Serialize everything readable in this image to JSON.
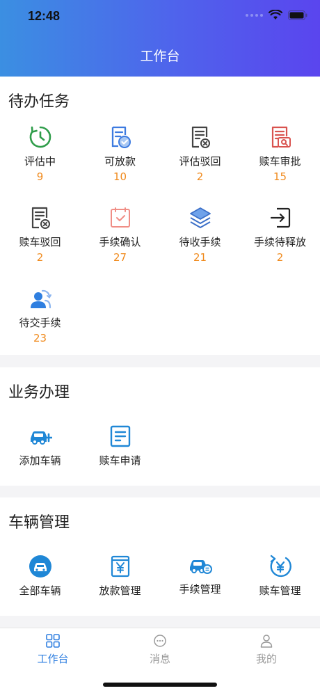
{
  "status": {
    "time": "12:48"
  },
  "header": {
    "title": "工作台"
  },
  "todo": {
    "title": "待办任务",
    "items": [
      {
        "label": "评估中",
        "count": "9",
        "icon": "clock-icon"
      },
      {
        "label": "可放款",
        "count": "10",
        "icon": "doc-check-icon"
      },
      {
        "label": "评估驳回",
        "count": "2",
        "icon": "doc-reject-icon"
      },
      {
        "label": "赎车审批",
        "count": "15",
        "icon": "doc-search-icon"
      },
      {
        "label": "赎车驳回",
        "count": "2",
        "icon": "doc-reject-icon"
      },
      {
        "label": "手续确认",
        "count": "27",
        "icon": "calendar-check-icon"
      },
      {
        "label": "待收手续",
        "count": "21",
        "icon": "layers-icon"
      },
      {
        "label": "手续待释放",
        "count": "2",
        "icon": "exit-icon"
      },
      {
        "label": "待交手续",
        "count": "23",
        "icon": "user-transfer-icon"
      }
    ]
  },
  "business": {
    "title": "业务办理",
    "items": [
      {
        "label": "添加车辆",
        "icon": "car-add-icon"
      },
      {
        "label": "赎车申请",
        "icon": "document-icon"
      }
    ]
  },
  "vehicle": {
    "title": "车辆管理",
    "items": [
      {
        "label": "全部车辆",
        "icon": "car-circle-icon"
      },
      {
        "label": "放款管理",
        "icon": "yen-receipt-icon"
      },
      {
        "label": "手续管理",
        "icon": "car-doc-icon"
      },
      {
        "label": "赎车管理",
        "icon": "yen-return-icon"
      }
    ]
  },
  "tabs": [
    {
      "label": "工作台",
      "icon": "grid-icon",
      "active": true
    },
    {
      "label": "消息",
      "icon": "message-icon",
      "active": false
    },
    {
      "label": "我的",
      "icon": "person-icon",
      "active": false
    }
  ],
  "colors": {
    "accent": "#2f7fe0",
    "count": "#f08a1d",
    "inactive": "#999999"
  }
}
